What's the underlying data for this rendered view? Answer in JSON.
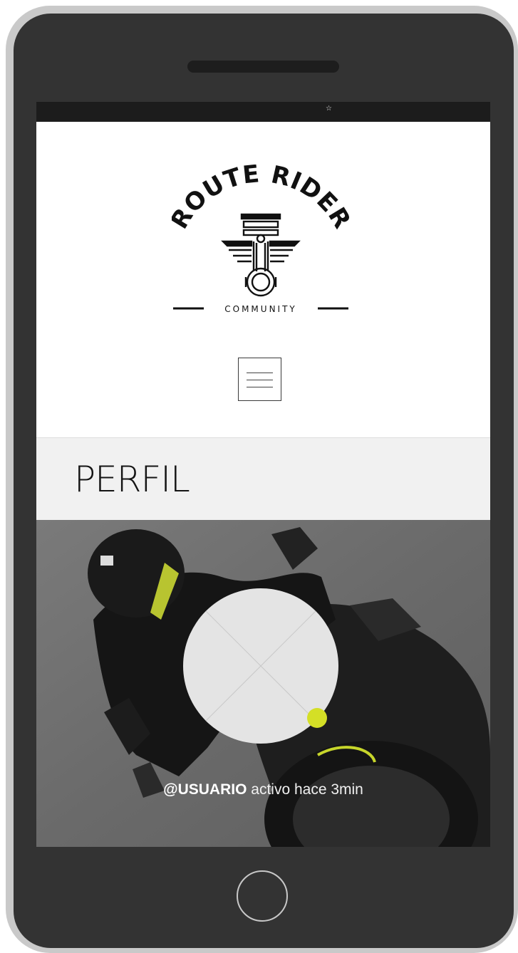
{
  "app": {
    "brand_top": "ROUTE RIDER",
    "brand_bottom": "COMMUNITY",
    "status_icon": "star-icon"
  },
  "page": {
    "title": "PERFIL"
  },
  "profile": {
    "username": "@USUARIO",
    "activity": "activo hace 3min",
    "status_color": "#d4df26"
  },
  "colors": {
    "device_frame": "#333333",
    "title_band": "#f1f1f1",
    "accent": "#d4df26"
  }
}
